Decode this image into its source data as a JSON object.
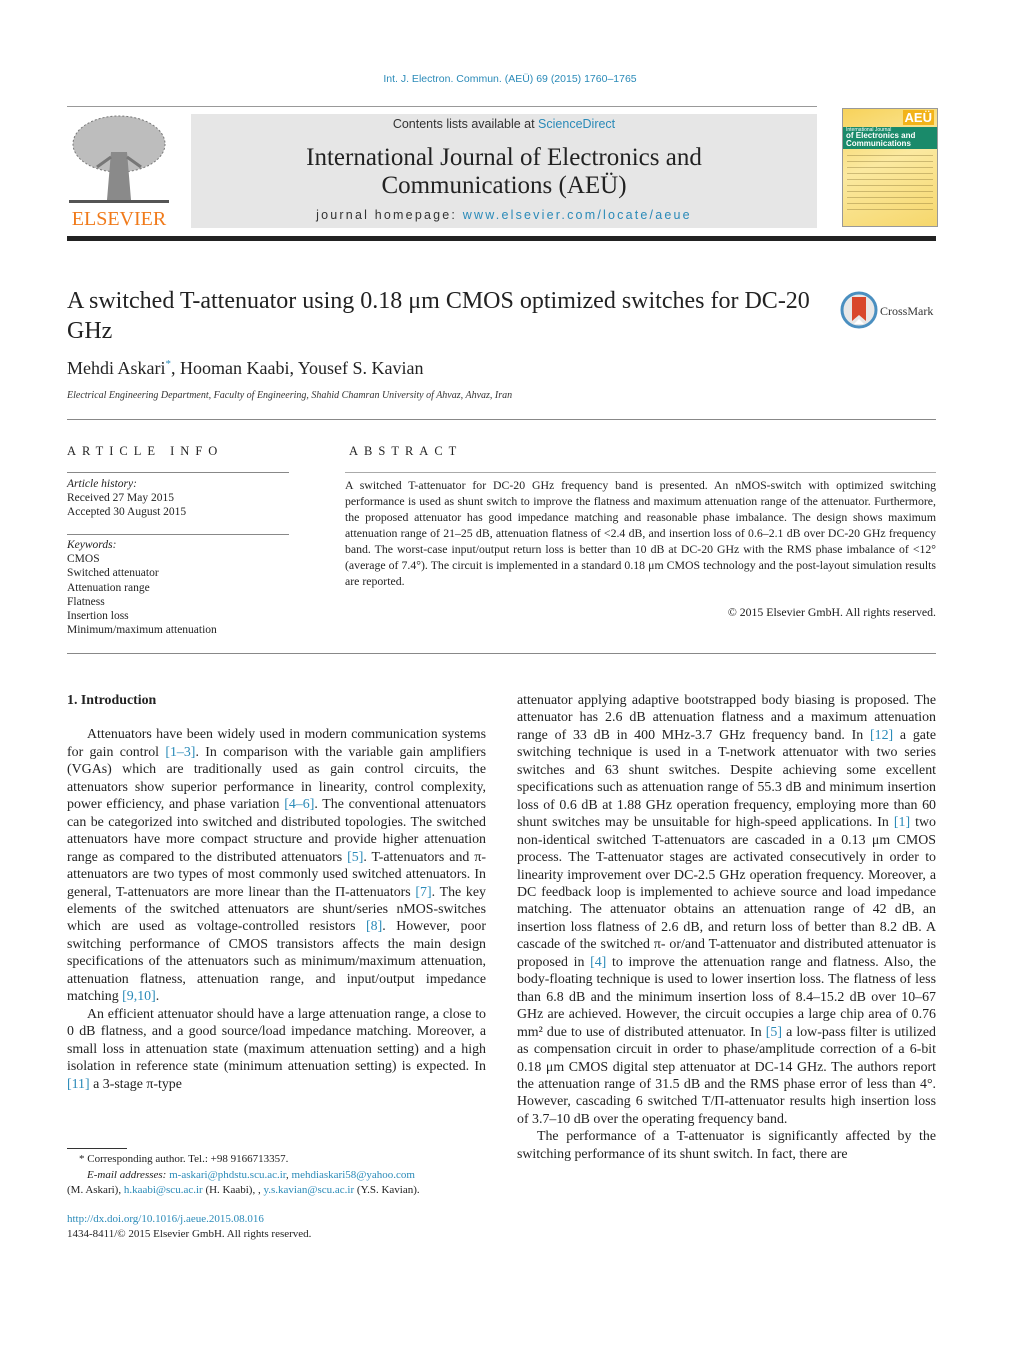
{
  "header": {
    "citation": "Int. J. Electron. Commun. (AEÜ) 69 (2015) 1760–1765",
    "contents_prefix": "Contents lists available at ",
    "contents_link": "ScienceDirect",
    "journal_title_line1": "International Journal of Electronics and",
    "journal_title_line2": "Communications (AEÜ)",
    "homepage_prefix": "journal homepage: ",
    "homepage_link": "www.elsevier.com/locate/aeue",
    "publisher_logo_text": "ELSEVIER",
    "cover": {
      "badge": "AEÜ",
      "line1": "International Journal",
      "line2": "of Electronics and",
      "line3": "Communications"
    },
    "colors": {
      "link": "#2a8ab8",
      "elsevier_orange": "#f07a1a",
      "banner_bg": "#e6e6e6"
    }
  },
  "article": {
    "title": "A switched T-attenuator using 0.18 μm CMOS optimized switches for DC-20 GHz",
    "crossmark_label": "CrossMark",
    "authors": [
      {
        "name": "Mehdi Askari",
        "mark": "*"
      },
      {
        "name": "Hooman Kaabi",
        "mark": ""
      },
      {
        "name": "Yousef S. Kavian",
        "mark": ""
      }
    ],
    "affiliation": "Electrical Engineering Department, Faculty of Engineering, Shahid Chamran University of Ahvaz, Ahvaz, Iran"
  },
  "article_info": {
    "label": "ARTICLE INFO",
    "history_heading": "Article history:",
    "received": "Received 27 May 2015",
    "accepted": "Accepted 30 August 2015",
    "keywords_heading": "Keywords:",
    "keywords": [
      "CMOS",
      "Switched attenuator",
      "Attenuation range",
      "Flatness",
      "Insertion loss",
      "Minimum/maximum attenuation"
    ]
  },
  "abstract": {
    "label": "ABSTRACT",
    "text": "A switched T-attenuator for DC-20 GHz frequency band is presented. An nMOS-switch with optimized switching performance is used as shunt switch to improve the flatness and maximum attenuation range of the attenuator. Furthermore, the proposed attenuator has good impedance matching and reasonable phase imbalance. The design shows maximum attenuation range of 21–25 dB, attenuation flatness of <2.4 dB, and insertion loss of 0.6–2.1 dB over DC-20 GHz frequency band. The worst-case input/output return loss is better than 10 dB at DC-20 GHz with the RMS phase imbalance of <12° (average of 7.4°). The circuit is implemented in a standard 0.18 μm CMOS technology and the post-layout simulation results are reported.",
    "copyright": "© 2015 Elsevier GmbH. All rights reserved."
  },
  "body": {
    "section_heading": "1.  Introduction",
    "p1": [
      "Attenuators have been widely used in modern communication systems for gain control ",
      "[1–3]",
      ". In comparison with the variable gain amplifiers (VGAs) which are traditionally used as gain control circuits, the attenuators show superior performance in linearity, control complexity, power efficiency, and phase variation ",
      "[4–6]",
      ". The conventional attenuators can be categorized into switched and distributed topologies. The switched attenuators have more compact structure and provide higher attenuation range as compared to the distributed attenuators ",
      "[5]",
      ". T-attenuators and π-attenuators are two types of most commonly used switched attenuators. In general, T-attenuators are more linear than the Π-attenuators ",
      "[7]",
      ". The key elements of the switched attenuators are shunt/series nMOS-switches which are used as voltage-controlled resistors ",
      "[8]",
      ". However, poor switching performance of CMOS transistors affects the main design specifications of the attenuators such as minimum/maximum attenuation, attenuation flatness, attenuation range, and input/output impedance matching ",
      "[9,10]",
      "."
    ],
    "p2": [
      "An efficient attenuator should have a large attenuation range, a close to 0 dB flatness, and a good source/load impedance matching. Moreover, a small loss in attenuation state (maximum attenuation setting) and a high isolation in reference state (minimum attenuation setting) is expected. In ",
      "[11]",
      " a 3-stage π-type attenuator applying adaptive bootstrapped body biasing is proposed. The attenuator has 2.6 dB attenuation flatness and a maximum attenuation range of 33 dB in 400 MHz-3.7 GHz frequency band. In ",
      "[12]",
      " a gate switching technique is used in a T-network attenuator with two series switches and 63 shunt switches. Despite achieving some excellent specifications such as attenuation range of 55.3 dB and minimum insertion loss of 0.6 dB at 1.88 GHz operation frequency, employing more than 60 shunt switches may be unsuitable for high-speed applications. In ",
      "[1]",
      " two non-identical switched T-attenuators are cascaded in a 0.13 μm CMOS process. The T-attenuator stages are activated consecutively in order to linearity improvement over DC-2.5 GHz operation frequency. Moreover, a DC feedback loop is implemented to achieve source and load impedance matching. The attenuator obtains an attenuation range of 42 dB, an insertion loss flatness of 2.6 dB, and return loss of better than 8.2 dB. A cascade of the switched π- or/and T-attenuator and distributed attenuator is proposed in ",
      "[4]",
      " to improve the attenuation range and flatness. Also, the body-floating technique is used to lower insertion loss. The flatness of less than 6.8 dB and the minimum insertion loss of 8.4–15.2 dB over 10–67 GHz are achieved. However, the circuit occupies a large chip area of 0.76 mm² due to use of distributed attenuator. In ",
      "[5]",
      " a low-pass filter is utilized as compensation circuit in order to phase/amplitude correction of a 6-bit 0.18 μm CMOS digital step attenuator at DC-14 GHz. The authors report the attenuation range of 31.5 dB and the RMS phase error of less than 4°. However, cascading 6 switched T/Π-attenuator results high insertion loss of 3.7–10 dB over the operating frequency band."
    ],
    "p3": "The performance of a T-attenuator is significantly affected by the switching performance of its shunt switch. In fact, there are"
  },
  "footnotes": {
    "corresponding": "*  Corresponding author. Tel.: +98 9166713357.",
    "email_label": "E-mail addresses: ",
    "email1": "m-askari@phdstu.scu.ac.ir",
    "email2": "mehdiaskari58@yahoo.com",
    "email2_owner": "(M. Askari), ",
    "email3": "h.kaabi@scu.ac.ir",
    "email3_owner": " (H. Kaabi), ",
    "email4": "y.s.kavian@scu.ac.ir",
    "email4_owner": " (Y.S. Kavian).",
    "doi": "http://dx.doi.org/10.1016/j.aeue.2015.08.016",
    "issn": "1434-8411/© 2015 Elsevier GmbH. All rights reserved."
  }
}
